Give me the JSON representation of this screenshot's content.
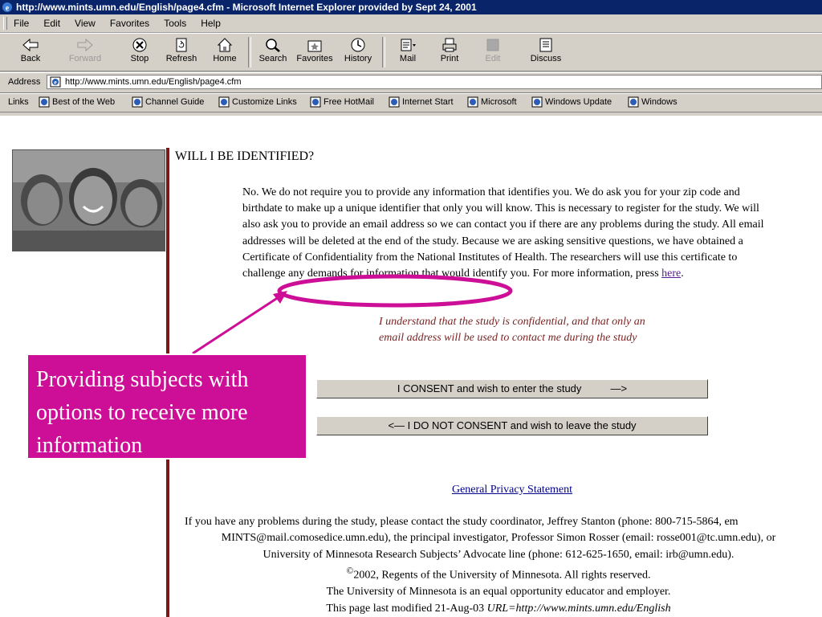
{
  "window": {
    "title": "http://www.mints.umn.edu/English/page4.cfm - Microsoft Internet Explorer provided by Sept 24, 2001"
  },
  "menu": [
    "File",
    "Edit",
    "View",
    "Favorites",
    "Tools",
    "Help"
  ],
  "toolbar": {
    "back": "Back",
    "forward": "Forward",
    "stop": "Stop",
    "refresh": "Refresh",
    "home": "Home",
    "search": "Search",
    "favorites": "Favorites",
    "history": "History",
    "mail": "Mail",
    "print": "Print",
    "edit": "Edit",
    "discuss": "Discuss"
  },
  "address": {
    "label": "Address",
    "url": "http://www.mints.umn.edu/English/page4.cfm"
  },
  "links": {
    "label": "Links",
    "items": [
      "Best of the Web",
      "Channel Guide",
      "Customize Links",
      "Free HotMail",
      "Internet Start",
      "Microsoft",
      "Windows Update",
      "Windows"
    ]
  },
  "page": {
    "heading": "WILL I BE IDENTIFIED?",
    "paragraph": "No. We do not require you to provide any information that identifies you. We do ask you for your zip code and birthdate to make up a unique identifier that only you will know. This is necessary to register for the study. We will also ask you to provide an email address so we can contact you if there are any problems during the study. All email addresses will be deleted at the end of the study. Because we are asking sensitive questions, we have obtained a Certificate of Confidentiality from the National Institutes of Health. The researchers will use this certificate to challenge any demands for information that would identify you. For more information, press",
    "link_text": "here",
    "note": "I understand that the study is confidential, and that only an email address will be used to contact me during the study",
    "consent_button": "I CONSENT and wish to enter the study          —>",
    "noconsent_button": "<— I DO NOT CONSENT and wish to leave the study",
    "privacy_link": "General Privacy Statement",
    "footer_line1": "If you have any problems during the study, please contact the study coordinator, Jeffrey Stanton (phone: 800-715-5864, em",
    "footer_line2": "MINTS@mail.comosedice.umn.edu), the principal investigator, Professor Simon Rosser (email: rosse001@tc.umn.edu), or",
    "footer_line3": "University of Minnesota Research Subjects’ Advocate line (phone: 612-625-1650, email: irb@umn.edu).",
    "copyright_symbol": "©",
    "copyright": "2002, Regents of the University of Minnesota. All rights reserved.",
    "eeo": "The University of Minnesota is an equal opportunity educator and employer.",
    "modified": "This page last modified 21-Aug-03 ",
    "modified_url": "URL=http://www.mints.umn.edu/English"
  },
  "annotation": {
    "callout": "Providing subjects with options to receive more information",
    "color": "#cc0f96"
  }
}
